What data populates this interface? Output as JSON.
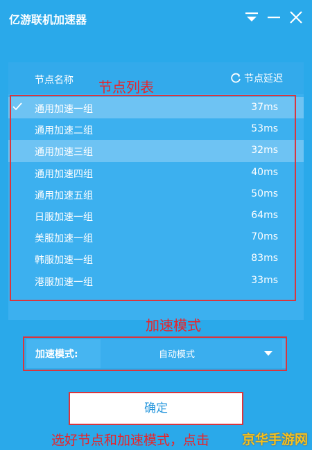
{
  "app": {
    "title": "亿游联机加速器"
  },
  "list_header": {
    "name_col": "节点名称",
    "latency_btn": "节点延迟"
  },
  "nodes": [
    {
      "name": "通用加速一组",
      "latency": "37ms",
      "selected": true
    },
    {
      "name": "通用加速二组",
      "latency": "53ms"
    },
    {
      "name": "通用加速三组",
      "latency": "32ms"
    },
    {
      "name": "通用加速四组",
      "latency": "40ms"
    },
    {
      "name": "通用加速五组",
      "latency": "50ms"
    },
    {
      "name": "日服加速一组",
      "latency": "64ms"
    },
    {
      "name": "美服加速一组",
      "latency": "70ms"
    },
    {
      "name": "韩服加速一组",
      "latency": "83ms"
    },
    {
      "name": "港服加速一组",
      "latency": "33ms"
    }
  ],
  "mode": {
    "label": "加速模式:",
    "value": "自动模式"
  },
  "confirm_label": "确定",
  "annotations": {
    "node_list": "节点列表",
    "accel_mode": "加速模式",
    "instruction": "选好节点和加速模式，点击"
  },
  "watermark": "京华手游网"
}
